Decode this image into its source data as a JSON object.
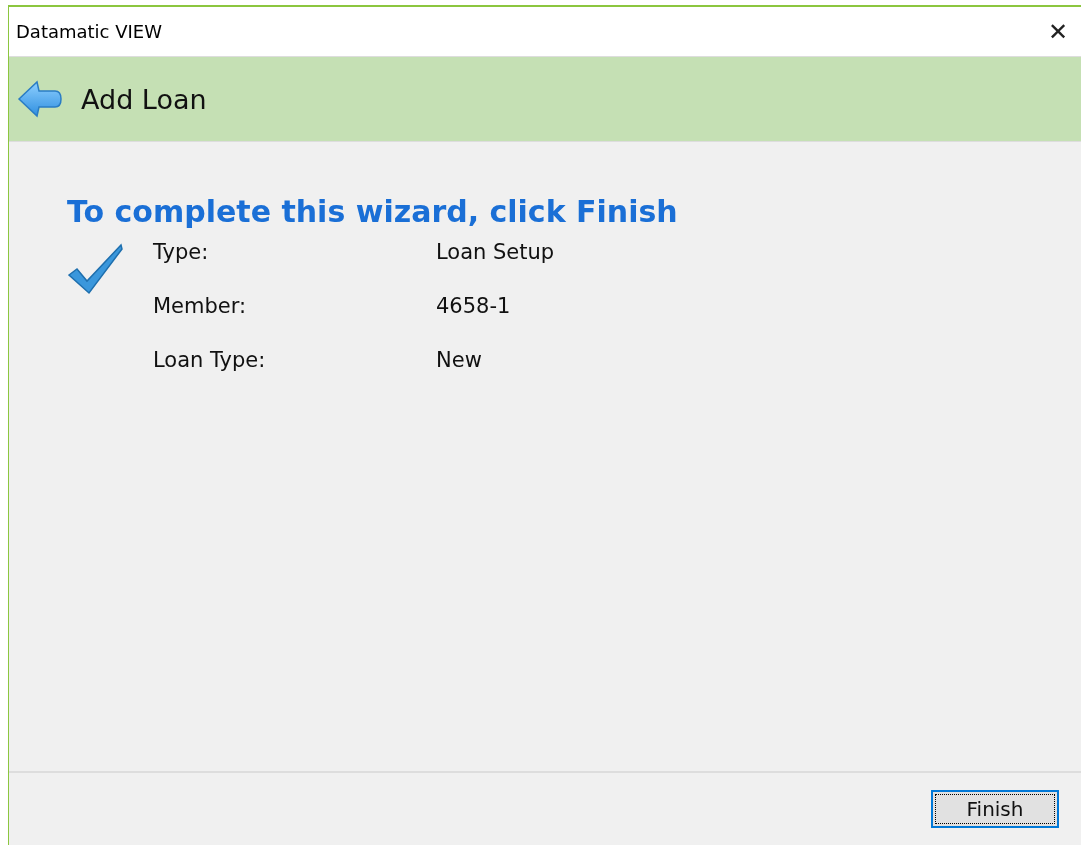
{
  "window": {
    "title": "Datamatic VIEW",
    "close": "✕"
  },
  "header": {
    "title": "Add Loan"
  },
  "heading": "To complete this wizard, click Finish",
  "summary": [
    {
      "label": "Type:",
      "value": "Loan Setup"
    },
    {
      "label": "Member:",
      "value": "4658-1"
    },
    {
      "label": "Loan Type:",
      "value": "New"
    }
  ],
  "buttons": [
    {
      "label": "Finish",
      "focused": true
    }
  ]
}
